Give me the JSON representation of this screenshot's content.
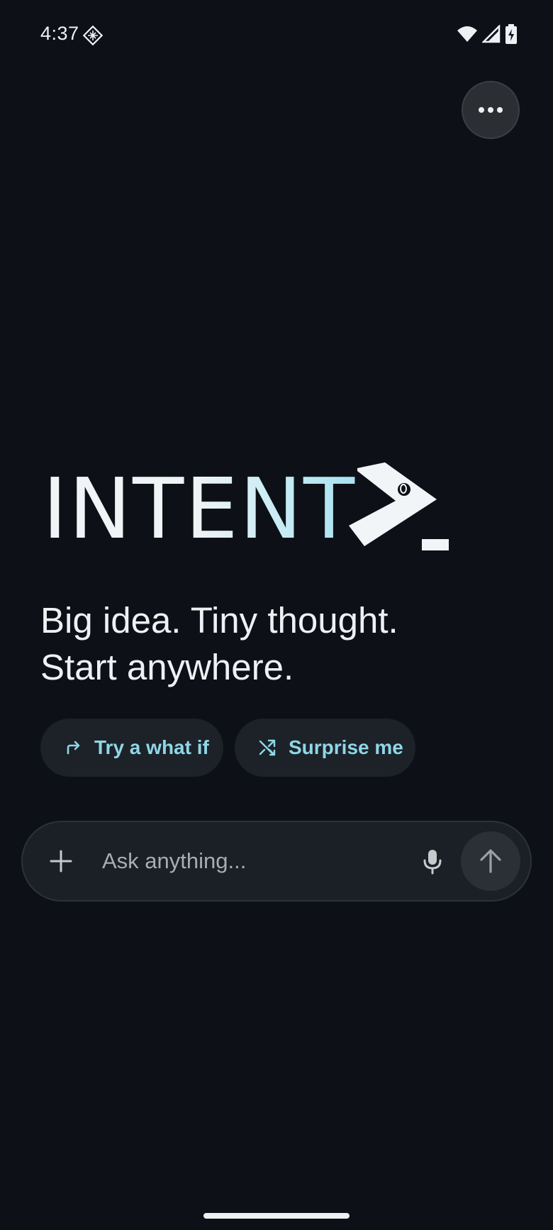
{
  "status_bar": {
    "time": "4:37",
    "icons": [
      "nfc-icon",
      "wifi-icon",
      "signal-icon",
      "battery-charging-icon"
    ]
  },
  "header": {
    "more_icon": "more-horizontal-icon"
  },
  "logo": {
    "text": "INTENT",
    "symbol": "prompt-chevron-icon"
  },
  "hero": {
    "line1": "Big idea. Tiny thought.",
    "line2": "Start anywhere."
  },
  "suggestions": [
    {
      "label": "Try a what if",
      "icon": "redo-arrow-icon"
    },
    {
      "label": "Surprise me",
      "icon": "shuffle-icon"
    }
  ],
  "composer": {
    "placeholder": "Ask anything...",
    "add_icon": "plus-icon",
    "mic_icon": "microphone-icon",
    "send_icon": "arrow-up-icon"
  },
  "colors": {
    "background": "#0d1117",
    "accent": "#8fd6e8",
    "chip_bg": "#1c2227",
    "input_bg": "#1a2025"
  }
}
